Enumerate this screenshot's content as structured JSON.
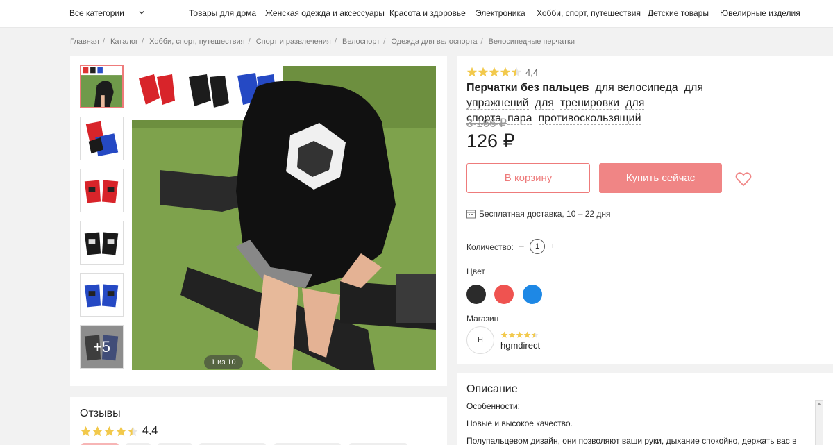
{
  "nav": {
    "all_categories": "Все категории",
    "items": [
      "Товары для дома",
      "Женская одежда и аксессуары",
      "Красота и здоровье",
      "Электроника",
      "Хобби, спорт, путешествия",
      "Детские товары",
      "Ювелирные изделия"
    ]
  },
  "breadcrumb": [
    "Главная",
    "Каталог",
    "Хобби, спорт, путешествия",
    "Спорт и развлечения",
    "Велоспорт",
    "Одежда для велоспорта",
    "Велосипедные перчатки"
  ],
  "gallery": {
    "counter": "1 из 10",
    "more_label": "+5",
    "thumbnails": [
      "gloves-all-colors",
      "gloves-red-blue",
      "gloves-red",
      "gloves-black",
      "gloves-blue",
      "gloves-more"
    ]
  },
  "product": {
    "rating": "4,4",
    "rating_value": 4.4,
    "title_main": "Перчатки без пальцев",
    "title_tags": [
      "для велосипеда",
      "для упражнений",
      "для",
      "тренировки",
      "для спорта",
      "пара",
      "противоскользящий"
    ],
    "old_price": "3 166 ₽",
    "price": "126 ₽",
    "cart_button": "В корзину",
    "buy_button": "Купить сейчас",
    "delivery": "Бесплатная доставка, 10 – 22 дня",
    "quantity_label": "Количество:",
    "quantity_minus": "–",
    "quantity": "1",
    "quantity_plus": "+",
    "color_label": "Цвет",
    "colors": [
      "#2b2b2b",
      "#ef5350",
      "#1e88e5"
    ],
    "shop_label": "Магазин",
    "shop_avatar": "H",
    "shop_name": "hgmdirect"
  },
  "reviews": {
    "title": "Отзывы",
    "rating": "4,4"
  },
  "description": {
    "title": "Описание",
    "lines": [
      "Особенности:",
      "Новые и высокое качество.",
      "Полупальцевом дизайн, они позволяют ваши руки, дыхание спокойно, держать вас в"
    ]
  },
  "accent": "#f08585"
}
